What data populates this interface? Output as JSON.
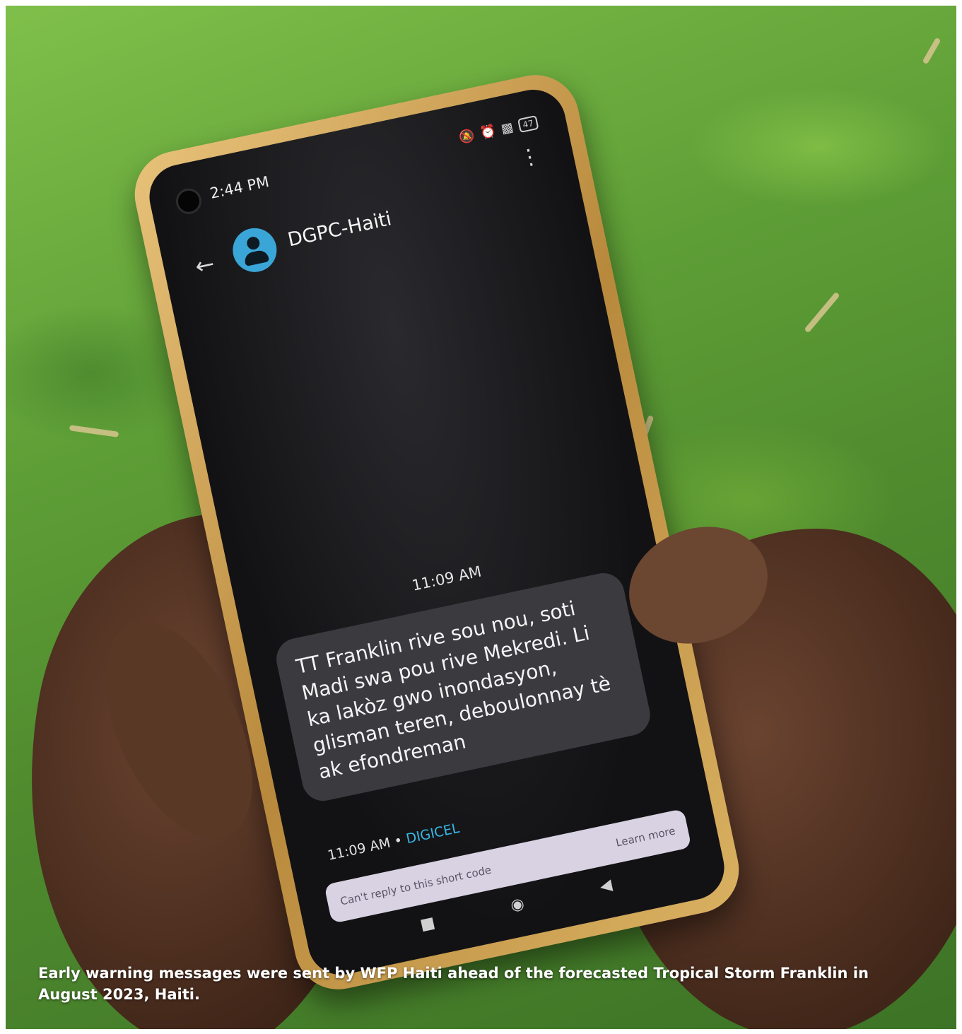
{
  "phone": {
    "status_time": "2:44 PM",
    "battery": "47",
    "contact_name": "DGPC-Haiti",
    "message_time": "11:09 AM",
    "message_text": "TT Franklin rive sou nou, soti Madi swa pou rive Mekredi. Li ka lakòz gwo inondasyon, glisman teren, deboulonnay tè ak efondreman",
    "meta_time": "11:09 AM",
    "meta_separator": "•",
    "carrier": "DIGICEL",
    "reply_notice": "Can't reply to this short code",
    "learn_more": "Learn more"
  },
  "caption": "Early warning messages were sent by WFP Haiti ahead of the forecasted Tropical Storm Franklin in August 2023, Haiti.",
  "colors": {
    "grass": "#5e9e36",
    "phone_frame": "#d9b061",
    "avatar": "#3aa6d8",
    "carrier_link": "#38b6e6"
  }
}
